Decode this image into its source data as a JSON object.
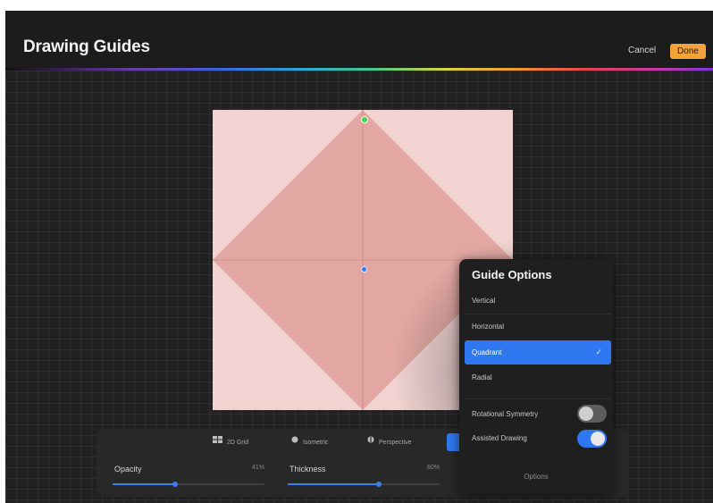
{
  "header": {
    "title": "Drawing Guides",
    "cancel_label": "Cancel",
    "done_label": "Done"
  },
  "colors": {
    "accent": "#2f78f0",
    "done_button": "#f2a33a",
    "canvas": "#f1d4d2",
    "diamond": "#e2a7a2"
  },
  "canvas": {
    "guide_type": "Quadrant",
    "nodes": [
      "top-handle-green",
      "center-handle-blue"
    ]
  },
  "bottom_panel": {
    "tabs": [
      {
        "label": "2D Grid",
        "icon": "grid-icon"
      },
      {
        "label": "Isometric",
        "icon": "isometric-icon"
      },
      {
        "label": "Perspective",
        "icon": "perspective-icon"
      }
    ],
    "opacity": {
      "label": "Opacity",
      "value": "41%",
      "fraction": 0.41
    },
    "thickness": {
      "label": "Thickness",
      "value": "60%",
      "fraction": 0.6
    }
  },
  "guide_options": {
    "title": "Guide Options",
    "items": [
      {
        "label": "Vertical",
        "selected": false
      },
      {
        "label": "Horizontal",
        "selected": false
      },
      {
        "label": "Quadrant",
        "selected": true
      },
      {
        "label": "Radial",
        "selected": false
      }
    ],
    "check_mark": "✓",
    "rotational_symmetry": {
      "label": "Rotational Symmetry",
      "on": false
    },
    "assisted_drawing": {
      "label": "Assisted Drawing",
      "on": true
    },
    "footer": "Options"
  }
}
